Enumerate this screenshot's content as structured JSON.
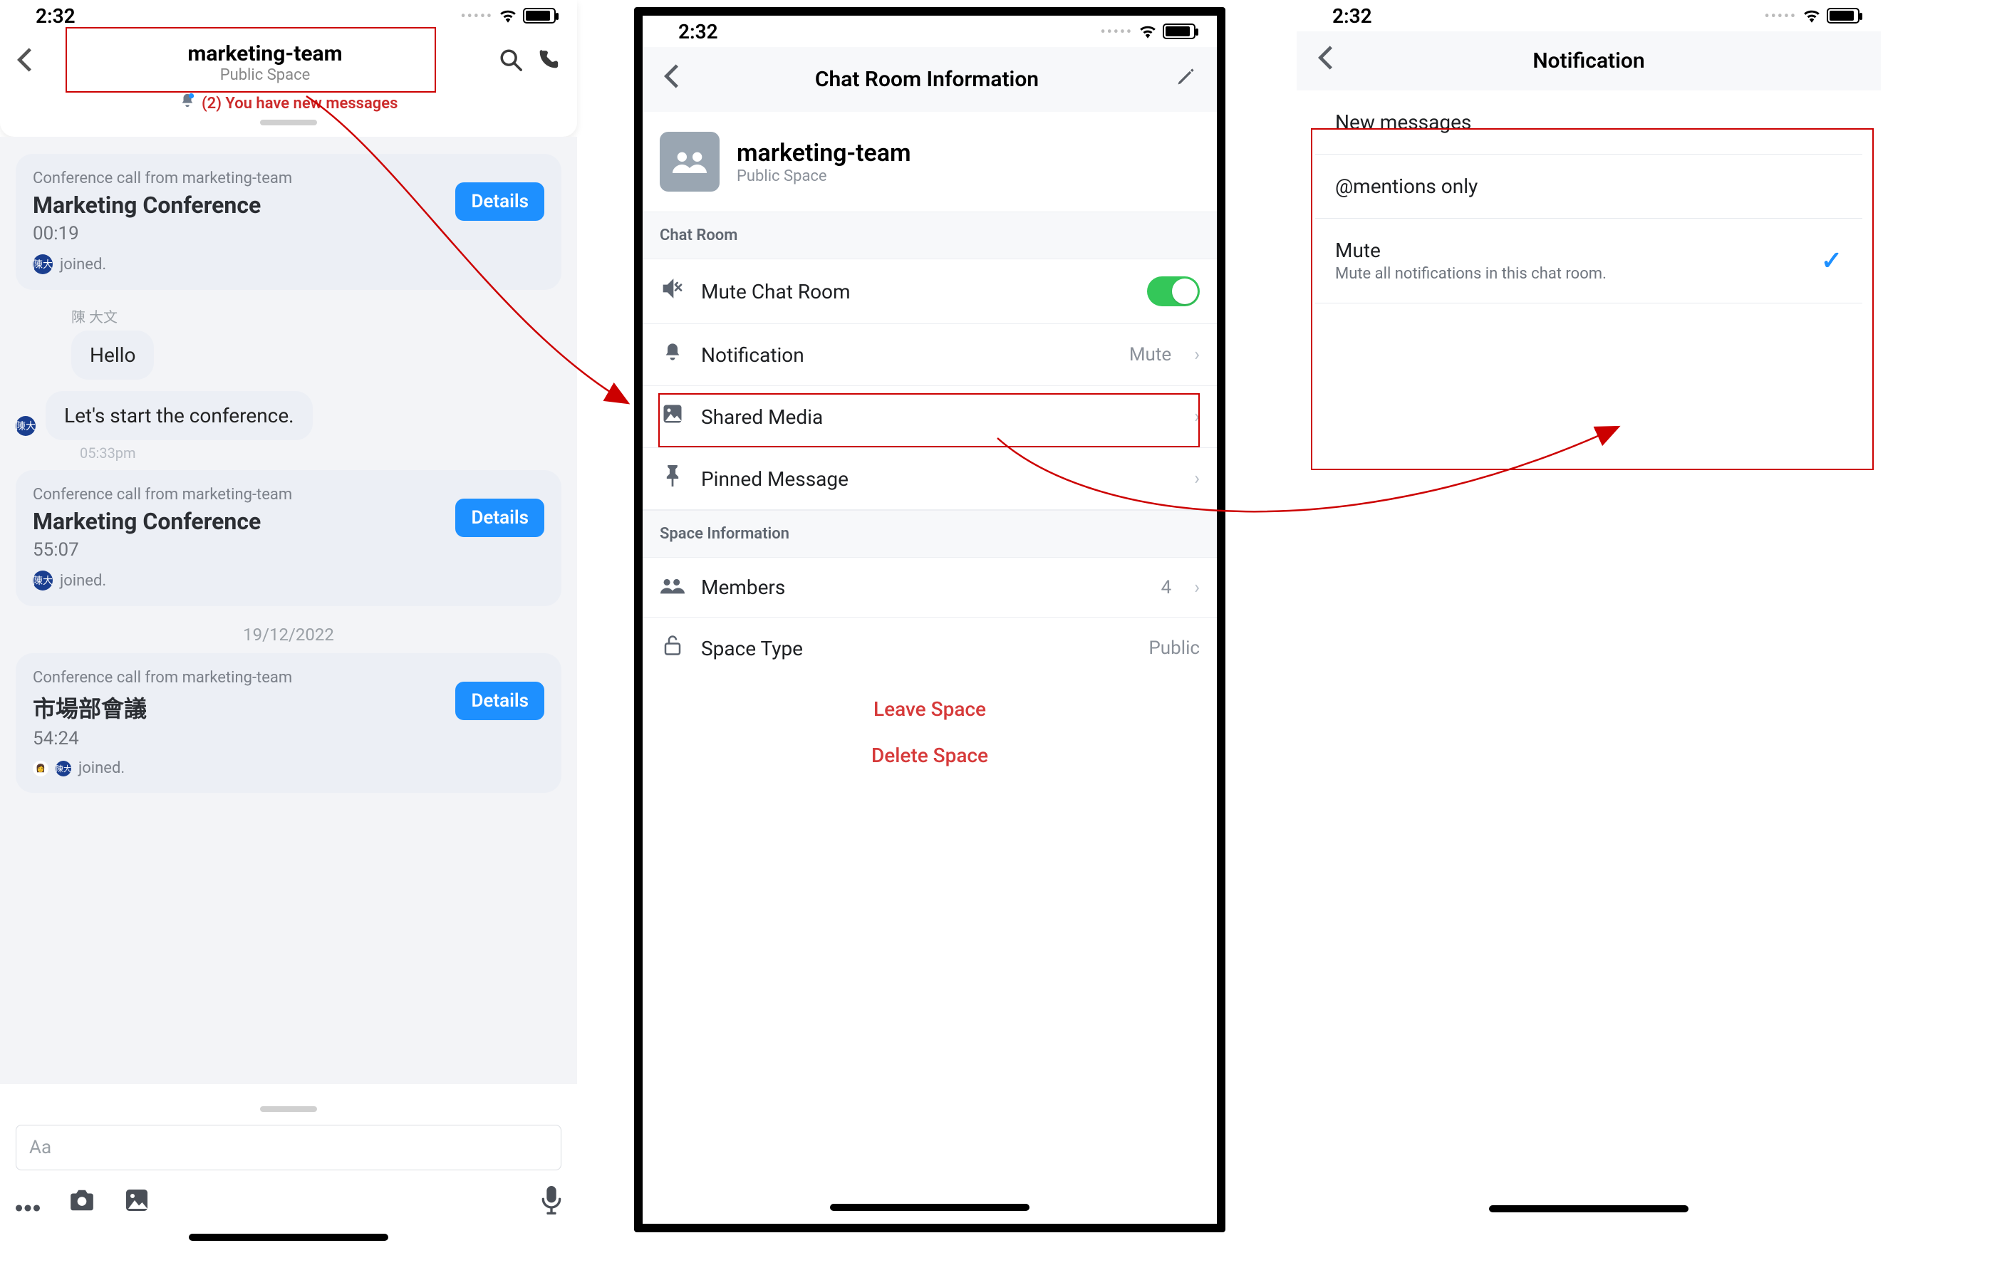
{
  "status": {
    "time": "2:32"
  },
  "screen1": {
    "title": "marketing-team",
    "subtitle": "Public Space",
    "notif_banner": "(2) You have new messages",
    "cards": [
      {
        "line1": "Conference call from marketing-team",
        "line2": "Marketing Conference",
        "line3": "00:19",
        "btn": "Details",
        "joined": " joined."
      },
      {
        "line1": "Conference call from marketing-team",
        "line2": "Marketing Conference",
        "line3": "55:07",
        "btn": "Details",
        "joined": " joined."
      },
      {
        "line1": "Conference call from marketing-team",
        "line2": "市場部會議",
        "line3": "54:24",
        "btn": "Details",
        "joined": " joined."
      }
    ],
    "sender_name": "陳 大文",
    "msg1": "Hello",
    "msg2": "Let's start the conference.",
    "msg_time": "05:33pm",
    "date_sep": "19/12/2022",
    "placeholder": "Aa"
  },
  "screen2": {
    "header": "Chat Room Information",
    "room_name": "marketing-team",
    "room_sub": "Public Space",
    "section1": "Chat Room",
    "rows1": {
      "mute": "Mute Chat Room",
      "notif": "Notification",
      "notif_val": "Mute",
      "media": "Shared Media",
      "pinned": "Pinned Message"
    },
    "section2": "Space Information",
    "rows2": {
      "members": "Members",
      "members_val": "4",
      "space_type": "Space Type",
      "space_type_val": "Public"
    },
    "leave": "Leave Space",
    "delete": "Delete Space"
  },
  "screen3": {
    "header": "Notification",
    "opts": {
      "new": "New messages",
      "mentions": "@mentions only",
      "mute": "Mute",
      "mute_sub": "Mute all notifications in this chat room."
    }
  }
}
